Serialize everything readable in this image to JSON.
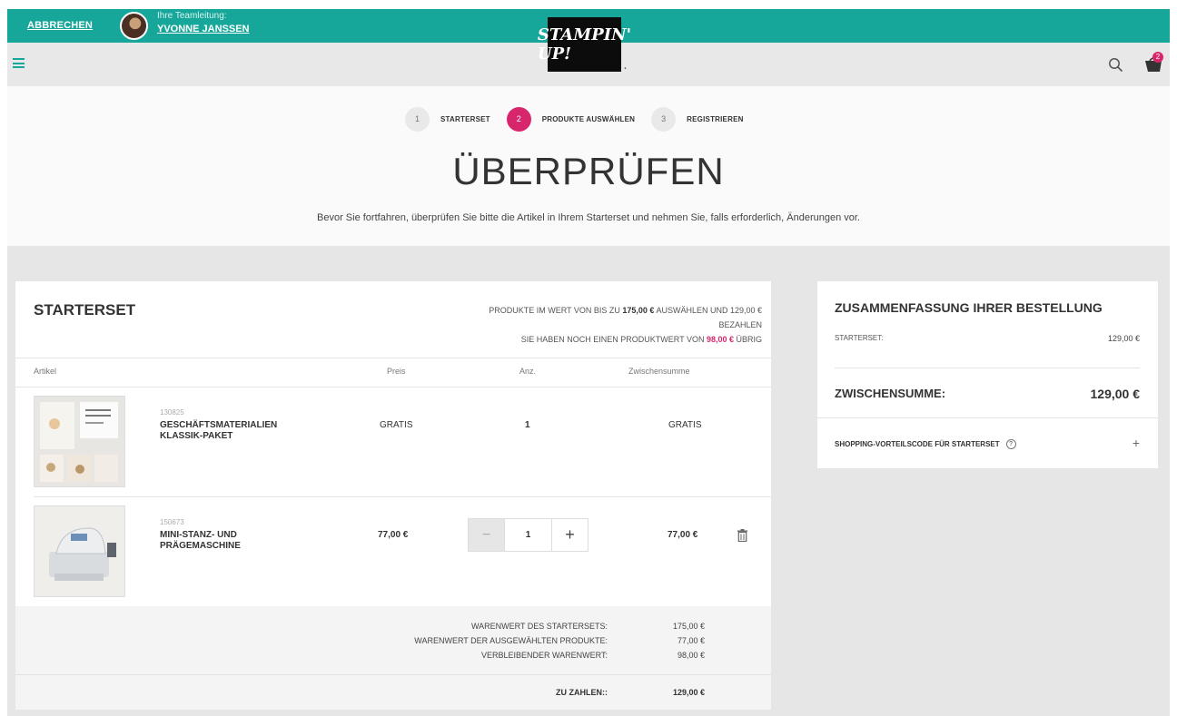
{
  "topbar": {
    "cancel_label": "ABBRECHEN",
    "team_lead_label": "Ihre Teamleitung:",
    "team_lead_name": "YVONNE JANSSEN"
  },
  "navbar": {
    "logo_text": "STAMPIN' UP!",
    "cart_count": "2"
  },
  "colors": {
    "teal": "#16a79a",
    "pink": "#d8266d"
  },
  "steps": [
    {
      "number": "1",
      "label": "STARTERSET",
      "active": false
    },
    {
      "number": "2",
      "label": "PRODUKTE AUSWÄHLEN",
      "active": true
    },
    {
      "number": "3",
      "label": "REGISTRIEREN",
      "active": false
    }
  ],
  "page": {
    "title": "ÜBERPRÜFEN",
    "intro": "Bevor Sie fortfahren, überprüfen Sie bitte die Artikel in Ihrem Starterset und nehmen Sie, falls erforderlich, Änderungen vor."
  },
  "starterset": {
    "title": "STARTERSET",
    "info_line1_a": "PRODUKTE IM WERT VON BIS ZU ",
    "info_line1_b": "175,00 €",
    "info_line1_c": " AUSWÄHLEN UND 129,00 €",
    "info_line2": "BEZAHLEN",
    "info_line3_a": "SIE HABEN NOCH EINEN PRODUKTWERT VON ",
    "info_line3_b": "98,00 €",
    "info_line3_c": " ÜBRIG",
    "columns": {
      "article": "Artikel",
      "price": "Preis",
      "qty": "Anz.",
      "subtotal": "Zwischensumme"
    },
    "items": [
      {
        "sku": "130825",
        "name": "GESCHÄFTSMATERIALIEN KLASSIK-PAKET",
        "price": "GRATIS",
        "qty": "1",
        "subtotal": "GRATIS"
      },
      {
        "sku": "150673",
        "name": "MINI-STANZ- UND PRÄGEMASCHINE",
        "price": "77,00 €",
        "qty": "1",
        "subtotal": "77,00 €"
      }
    ],
    "totals": {
      "set_value_label": "WARENWERT DES STARTERSETS:",
      "set_value": "175,00 €",
      "selected_label": "WARENWERT DER AUSGEWÄHLTEN PRODUKTE:",
      "selected_value": "77,00 €",
      "remaining_label": "VERBLEIBENDER WARENWERT:",
      "remaining_value": "98,00 €",
      "pay_label": "ZU ZAHLEN::",
      "pay_value": "129,00 €"
    },
    "stepper": {
      "minus": "−",
      "plus": "+"
    }
  },
  "summary": {
    "title": "ZUSAMMENFASSUNG IHRER BESTELLUNG",
    "starterset_label": "STARTERSET:",
    "starterset_value": "129,00 €",
    "subtotal_label": "ZWISCHENSUMME:",
    "subtotal_value": "129,00 €",
    "promo_label": "SHOPPING-VORTEILSCODE FÜR STARTERSET",
    "promo_help": "?",
    "promo_toggle": "+"
  }
}
